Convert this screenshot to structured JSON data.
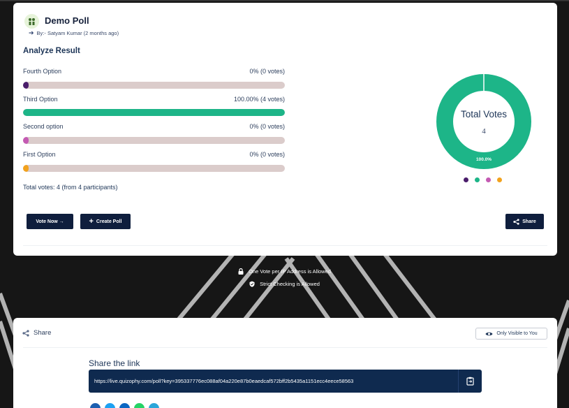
{
  "poll": {
    "title": "Demo Poll",
    "byline": "By:- Satyam Kumar (2 months ago)"
  },
  "result": {
    "heading": "Analyze Result",
    "options": [
      {
        "label": "Fourth Option",
        "stat": "0% (0 votes)",
        "percent": 0,
        "color": "#4a1d6b"
      },
      {
        "label": "Third Option",
        "stat": "100.00% (4 votes)",
        "percent": 100,
        "color": "#1db588"
      },
      {
        "label": "Second option",
        "stat": "0% (0 votes)",
        "percent": 0,
        "color": "#c45ab3"
      },
      {
        "label": "First Option",
        "stat": "0% (0 votes)",
        "percent": 0,
        "color": "#f2a21d"
      }
    ],
    "total_line": "Total votes: 4 (from 4 participants)"
  },
  "buttons": {
    "vote_now": "Vote Now →",
    "create_poll": "Create Poll",
    "share": "Share"
  },
  "donut": {
    "center_title": "Total Votes",
    "center_value": "4",
    "slice_label": "100.0%"
  },
  "info": {
    "ip_rule": "One Vote per IP Address is Allowed",
    "strict": "Strict Checking is Allowed"
  },
  "share_panel": {
    "header": "Share",
    "visibility": "Only Visible to You",
    "link_title": "Share the link",
    "link": "https://live.quizophy.com/poll?key=395337776ec088af04a220e87b0eaedcaf572bff2b5435a1151ecc4eece58563"
  },
  "chart_data": {
    "type": "pie",
    "categories": [
      "Fourth Option",
      "Third Option",
      "Second option",
      "First Option"
    ],
    "values": [
      0,
      4,
      0,
      0
    ],
    "title": "",
    "xlabel": "",
    "ylabel": ""
  }
}
